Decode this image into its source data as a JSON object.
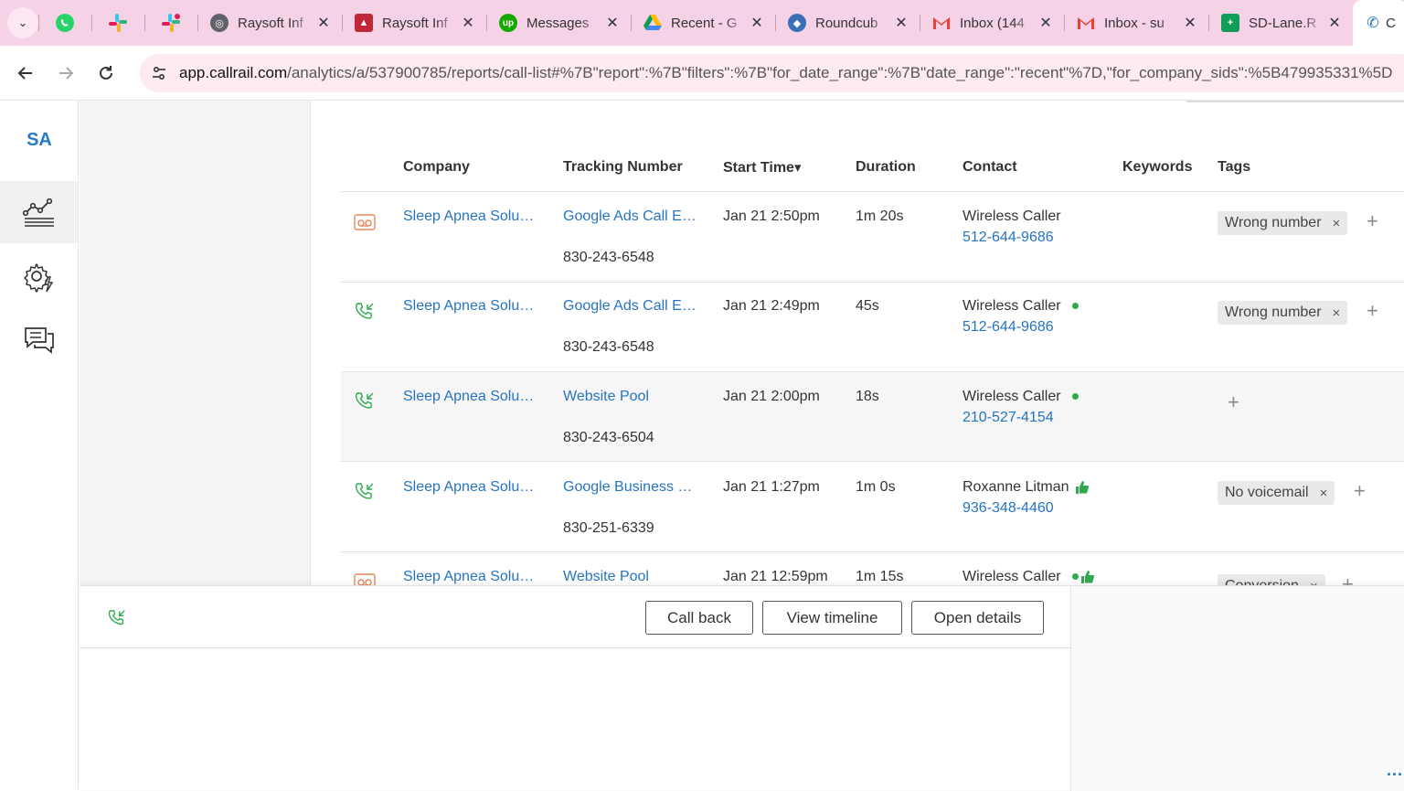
{
  "browser": {
    "tabs": [
      {
        "title": "Raysoft Inf",
        "favicon": "globe-icon"
      },
      {
        "title": "Raysoft Inf",
        "favicon": "hat-icon"
      },
      {
        "title": "Messages",
        "favicon": "upwork-icon"
      },
      {
        "title": "Recent - G",
        "favicon": "drive-icon"
      },
      {
        "title": "Roundcub",
        "favicon": "roundcube-icon"
      },
      {
        "title": "Inbox (144",
        "favicon": "gmail-icon"
      },
      {
        "title": "Inbox - su",
        "favicon": "gmail-icon"
      },
      {
        "title": "SD-Lane.R",
        "favicon": "sheets-icon"
      },
      {
        "title": "C",
        "favicon": "callrail-icon"
      }
    ],
    "url_domain": "app.callrail.com",
    "url_path": "/analytics/a/537900785/reports/call-list#%7B\"report\":%7B\"filters\":%7B\"for_date_range\":%7B\"date_range\":\"recent\"%7D,\"for_company_sids\":%5B479935331%5D"
  },
  "nav": {
    "logo": "SA"
  },
  "table": {
    "headers": {
      "company": "Company",
      "tracking": "Tracking Number",
      "start": "Start Time",
      "start_sort": "▾",
      "duration": "Duration",
      "contact": "Contact",
      "keywords": "Keywords",
      "tags": "Tags"
    },
    "rows": [
      {
        "company": "Sleep Apnea Solu…",
        "source": "Google Ads Call E…",
        "number": "830-243-6548",
        "start": "Jan 21 2:50pm",
        "duration": "1m 20s",
        "contact": "Wireless Caller",
        "phone": "512-644-9686",
        "tag": "Wrong number",
        "tag_remove": "×",
        "add": "+"
      },
      {
        "company": "Sleep Apnea Solu…",
        "source": "Google Ads Call E…",
        "number": "830-243-6548",
        "start": "Jan 21 2:49pm",
        "duration": "45s",
        "contact": "Wireless Caller",
        "phone": "512-644-9686",
        "tag": "Wrong number",
        "tag_remove": "×",
        "add": "+"
      },
      {
        "company": "Sleep Apnea Solu…",
        "source": "Website Pool",
        "number": "830-243-6504",
        "start": "Jan 21 2:00pm",
        "duration": "18s",
        "contact": "Wireless Caller",
        "phone": "210-527-4154",
        "add": "+"
      },
      {
        "company": "Sleep Apnea Solu…",
        "source": "Google Business …",
        "number": "830-251-6339",
        "start": "Jan 21 1:27pm",
        "duration": "1m 0s",
        "contact": "Roxanne Litman",
        "phone": "936-348-4460",
        "tag": "No voicemail",
        "tag_remove": "×",
        "add": "+"
      },
      {
        "company": "Sleep Apnea Solu…",
        "source": "Website Pool",
        "start": "Jan 21 12:59pm",
        "duration": "1m 15s",
        "contact": "Wireless Caller",
        "tag": "Conversion",
        "tag_remove": "×",
        "add": "+"
      }
    ]
  },
  "panel": {
    "call_back": "Call back",
    "view_timeline": "View timeline",
    "open_details": "Open details",
    "more": "..."
  },
  "colors": {
    "tab_strip": "#f6d2e6",
    "link": "#2673bf",
    "voicemail": "#e8875a",
    "answered": "#2eaa4e"
  }
}
